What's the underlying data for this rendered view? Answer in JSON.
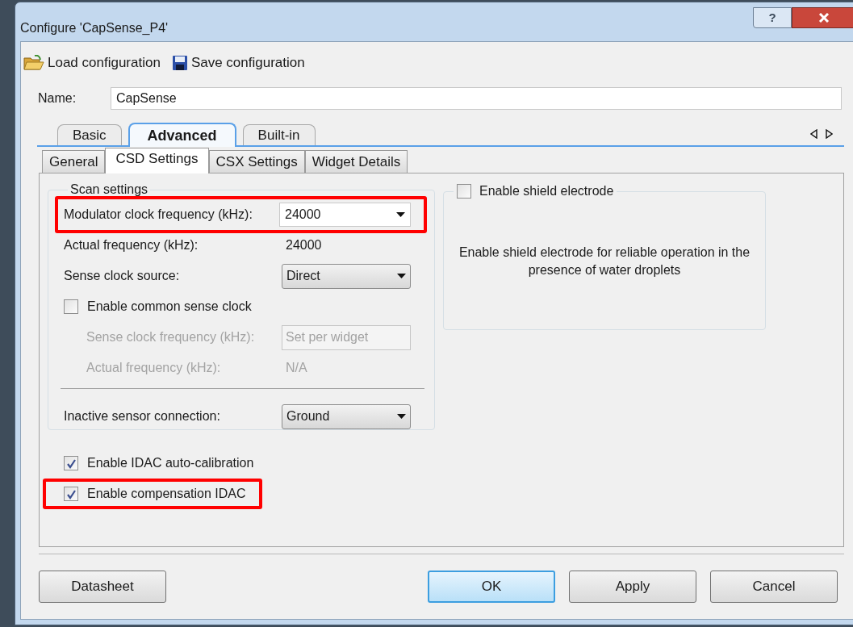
{
  "window": {
    "title": "Configure 'CapSense_P4'",
    "help_button": "?"
  },
  "toolbar": [
    {
      "label": "Load configuration",
      "kind": "load"
    },
    {
      "label": "Save configuration",
      "kind": "save"
    }
  ],
  "name_field": {
    "label": "Name:",
    "value": "CapSense"
  },
  "tabs": [
    {
      "label": "Basic",
      "selected": false
    },
    {
      "label": "Advanced",
      "selected": true
    },
    {
      "label": "Built-in",
      "selected": false
    }
  ],
  "subtabs": [
    {
      "label": "General",
      "selected": false
    },
    {
      "label": "CSD Settings",
      "selected": true
    },
    {
      "label": "CSX Settings",
      "selected": false
    },
    {
      "label": "Widget Details",
      "selected": false
    }
  ],
  "scan_settings": {
    "title": "Scan settings",
    "rows": [
      {
        "kind": "combobox",
        "label": "Modulator clock frequency (kHz):",
        "value": "24000",
        "highlighted": true,
        "disabled": false
      },
      {
        "kind": "readout",
        "label": "Actual frequency (kHz):",
        "value": "24000",
        "highlighted": false,
        "disabled": false
      },
      {
        "kind": "dropdown",
        "label": "Sense clock source:",
        "value": "Direct",
        "highlighted": false,
        "disabled": false
      },
      {
        "kind": "checkbox",
        "label": "Enable common sense clock",
        "checked": false,
        "highlighted": false,
        "disabled": false
      },
      {
        "kind": "textbox",
        "label": "Sense clock frequency (kHz):",
        "value": "Set per widget",
        "highlighted": false,
        "disabled": true
      },
      {
        "kind": "readout",
        "label": "Actual frequency (kHz):",
        "value": "N/A",
        "highlighted": false,
        "disabled": true
      },
      {
        "kind": "separator"
      },
      {
        "kind": "dropdown",
        "label": "Inactive sensor connection:",
        "value": "Ground",
        "highlighted": false,
        "disabled": false
      }
    ]
  },
  "options": [
    {
      "label": "Enable IDAC auto-calibration",
      "checked": true,
      "highlighted": false
    },
    {
      "label": "Enable compensation IDAC",
      "checked": true,
      "highlighted": true
    }
  ],
  "shield": {
    "label": "Enable shield electrode",
    "checked": false,
    "description": "Enable shield electrode for reliable operation in the presence of water droplets"
  },
  "buttons": [
    {
      "label": "Datasheet",
      "default": false
    },
    {
      "label": "OK",
      "default": true
    },
    {
      "label": "Apply",
      "default": false
    },
    {
      "label": "Cancel",
      "default": false
    }
  ]
}
